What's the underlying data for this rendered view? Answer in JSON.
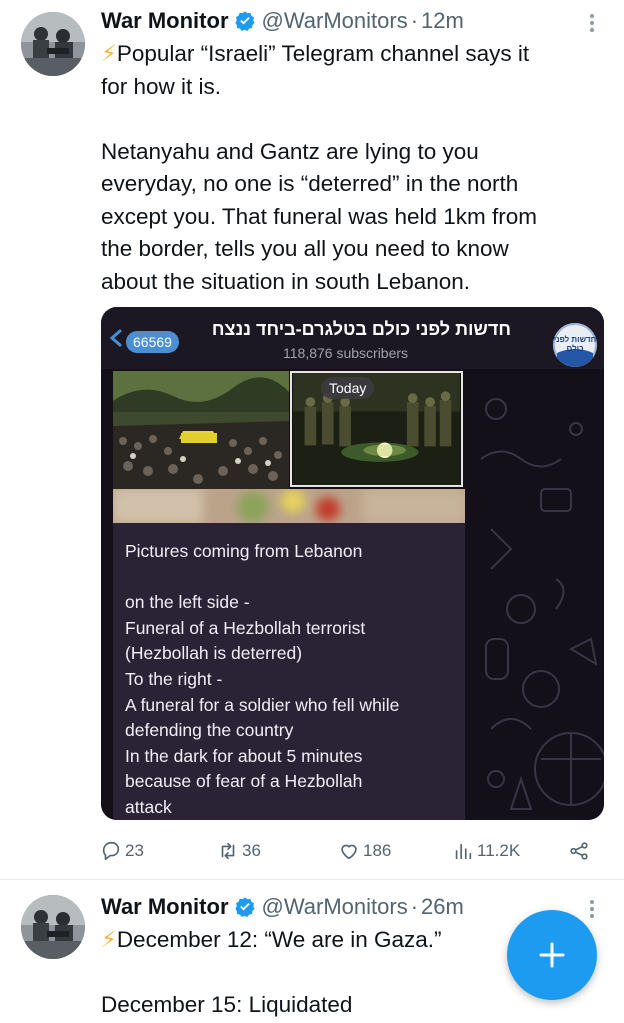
{
  "tweets": [
    {
      "author": {
        "name": "War Monitor",
        "handle": "@WarMonitors",
        "time": "12m"
      },
      "separator": "·",
      "text_lines": [
        {
          "emoji": "⚡",
          "text": "Popular “Israeli” Telegram channel says it"
        },
        {
          "text": "for how it is."
        },
        {
          "text": ""
        },
        {
          "text": "Netanyahu and Gantz are lying to you"
        },
        {
          "text": "everyday, no one is “deterred” in the north"
        },
        {
          "text": "except you. That funeral was held 1km from"
        },
        {
          "text": "the border, tells you all you need to know"
        },
        {
          "text": "about the situation in south Lebanon."
        }
      ],
      "media": {
        "channel_title": "חדשות לפני כולם בטלגרם-ביחד ננצח",
        "subscribers": "118,876 subscribers",
        "unread_badge": "66569",
        "channel_logo_text": "חדשות לפני כולם",
        "date_chip": "Today",
        "message_lines": [
          "Pictures coming from Lebanon",
          "",
          "on the left side -",
          "Funeral of a Hezbollah terrorist",
          "(Hezbollah is deterred)",
          "To the right -",
          "A funeral for a soldier who fell while",
          "defending the country",
          "In the dark for about 5 minutes",
          "because of fear of a Hezbollah",
          "attack"
        ]
      },
      "actions": {
        "replies": "23",
        "retweets": "36",
        "likes": "186",
        "views": "11.2K"
      }
    },
    {
      "author": {
        "name": "War Monitor",
        "handle": "@WarMonitors",
        "time": "26m"
      },
      "separator": "·",
      "text_lines": [
        {
          "emoji": "⚡",
          "text": "December 12: “We are in Gaza.”"
        },
        {
          "text": ""
        },
        {
          "text": "December 15: Liquidated"
        }
      ]
    }
  ],
  "icons": {
    "verified": "verified-badge-icon",
    "more": "more-dots-icon",
    "reply": "reply-icon",
    "retweet": "retweet-icon",
    "like": "heart-icon",
    "views": "views-icon",
    "share": "share-icon",
    "compose": "plus-icon"
  },
  "colors": {
    "accent": "#1d9bf0",
    "text": "#0f1419",
    "muted": "#536471",
    "bolt": "#f9b53b"
  }
}
